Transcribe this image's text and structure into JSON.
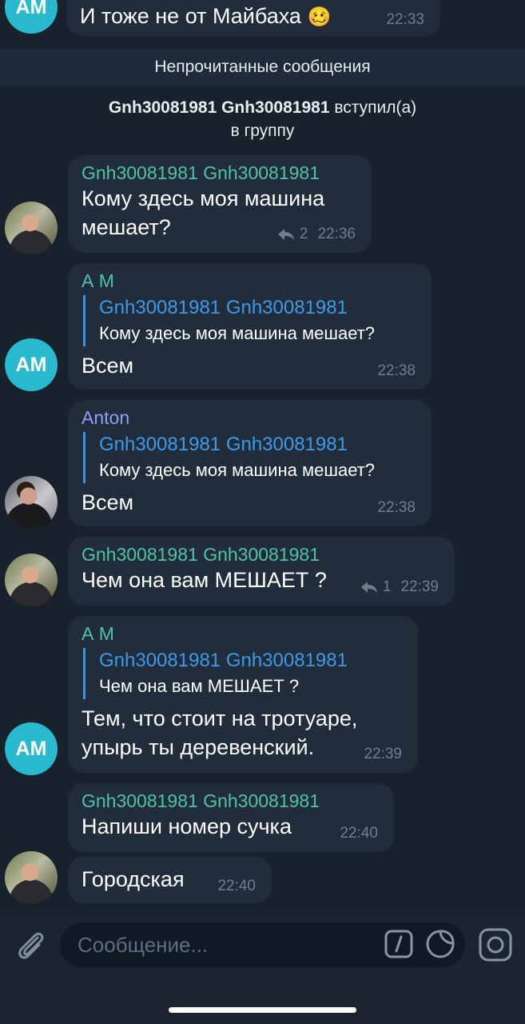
{
  "top_partial": {
    "text": "И тоже не от Майбаха",
    "emoji": "🥴",
    "time": "22:33",
    "avatar": "АМ"
  },
  "unread_bar": "Непрочитанные сообщения",
  "join_notice": {
    "user": "Gnh30081981 Gnh30081981",
    "action_line1": "вступил(а)",
    "action_line2": "в группу"
  },
  "messages": [
    {
      "sender": "Gnh30081981 Gnh30081981",
      "text_line1": "Кому здесь моя машина",
      "text_line2": "мешает?",
      "replies": "2",
      "time": "22:36"
    },
    {
      "sender": "А М",
      "avatar": "АМ",
      "reply_author": "Gnh30081981 Gnh30081981",
      "reply_text": "Кому здесь моя машина мешает?",
      "text": "Всем",
      "time": "22:38"
    },
    {
      "sender": "Anton",
      "reply_author": "Gnh30081981 Gnh30081981",
      "reply_text": "Кому здесь моя машина мешает?",
      "text": "Всем",
      "time": "22:38"
    },
    {
      "sender": "Gnh30081981 Gnh30081981",
      "text": "Чем она вам МЕШАЕТ ?",
      "replies": "1",
      "time": "22:39"
    },
    {
      "sender": "А М",
      "avatar": "АМ",
      "reply_author": "Gnh30081981 Gnh30081981",
      "reply_text": "Чем она вам МЕШАЕТ ?",
      "text_line1": "Тем, что стоит на тротуаре,",
      "text_line2": "упырь ты деревенский.",
      "time": "22:39"
    },
    {
      "sender": "Gnh30081981 Gnh30081981",
      "text": "Напиши номер сучка",
      "time": "22:40"
    },
    {
      "text": "Городская",
      "time": "22:40"
    }
  ],
  "composer": {
    "placeholder": "Сообщение..."
  },
  "colors": {
    "background": "#18222d",
    "bubble": "#212d3b",
    "sender_green": "#4fc2a8",
    "sender_blue": "#3d9ae8",
    "sender_purple": "#8f9ff5",
    "avatar_am": "#29b9cf"
  },
  "icons": [
    "attach-icon",
    "command-icon",
    "sticker-icon",
    "camera-icon",
    "reply-arrow-icon"
  ]
}
